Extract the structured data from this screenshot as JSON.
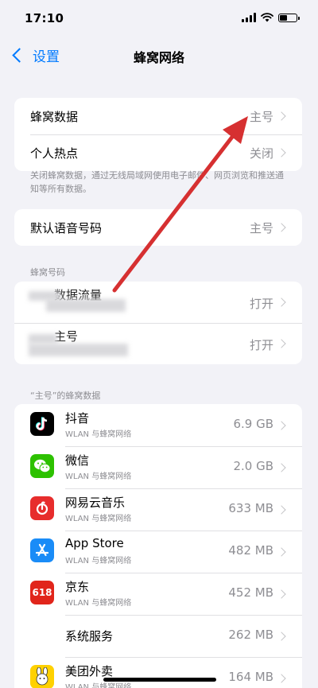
{
  "status_bar": {
    "time": "17:10",
    "battery_level": 0.45
  },
  "nav": {
    "back_label": "设置",
    "title": "蜂窝网络"
  },
  "cellular_group": {
    "items": [
      {
        "label": "蜂窝数据",
        "value": "主号"
      },
      {
        "label": "个人热点",
        "value": "关闭"
      }
    ],
    "footnote": "关闭蜂窝数据，通过无线局域网使用电子邮件、网页浏览和推送通知等所有数据。"
  },
  "voice_group": {
    "label": "默认语音号码",
    "value": "主号"
  },
  "sim_section": {
    "header": "蜂窝号码",
    "items": [
      {
        "label": "数据流量",
        "value": "打开"
      },
      {
        "label": "主号",
        "value": "打开"
      }
    ]
  },
  "usage_section": {
    "header": "“主号”的蜂窝数据",
    "apps": [
      {
        "name": "抖音",
        "sub": "WLAN 与蜂窝网络",
        "size": "6.9 GB",
        "icon": "douyin-icon",
        "color": "#000000"
      },
      {
        "name": "微信",
        "sub": "WLAN 与蜂窝网络",
        "size": "2.0 GB",
        "icon": "wechat-icon",
        "color": "#2dc100"
      },
      {
        "name": "网易云音乐",
        "sub": "WLAN 与蜂窝网络",
        "size": "633 MB",
        "icon": "netease-music-icon",
        "color": "#e72d2c"
      },
      {
        "name": "App Store",
        "sub": "WLAN 与蜂窝网络",
        "size": "482 MB",
        "icon": "app-store-icon",
        "color": "#1a8cf7"
      },
      {
        "name": "京东",
        "sub": "WLAN 与蜂窝网络",
        "size": "452 MB",
        "icon": "jd-icon",
        "color": "#e1251b",
        "icon_text": "618"
      },
      {
        "name": "系统服务",
        "size": "262 MB"
      },
      {
        "name": "美团外卖",
        "sub": "WLAN 与蜂窝网络",
        "size": "164 MB",
        "icon": "meituan-icon",
        "color": "#ffd100"
      }
    ]
  },
  "annotation": {
    "color": "#d63031"
  }
}
